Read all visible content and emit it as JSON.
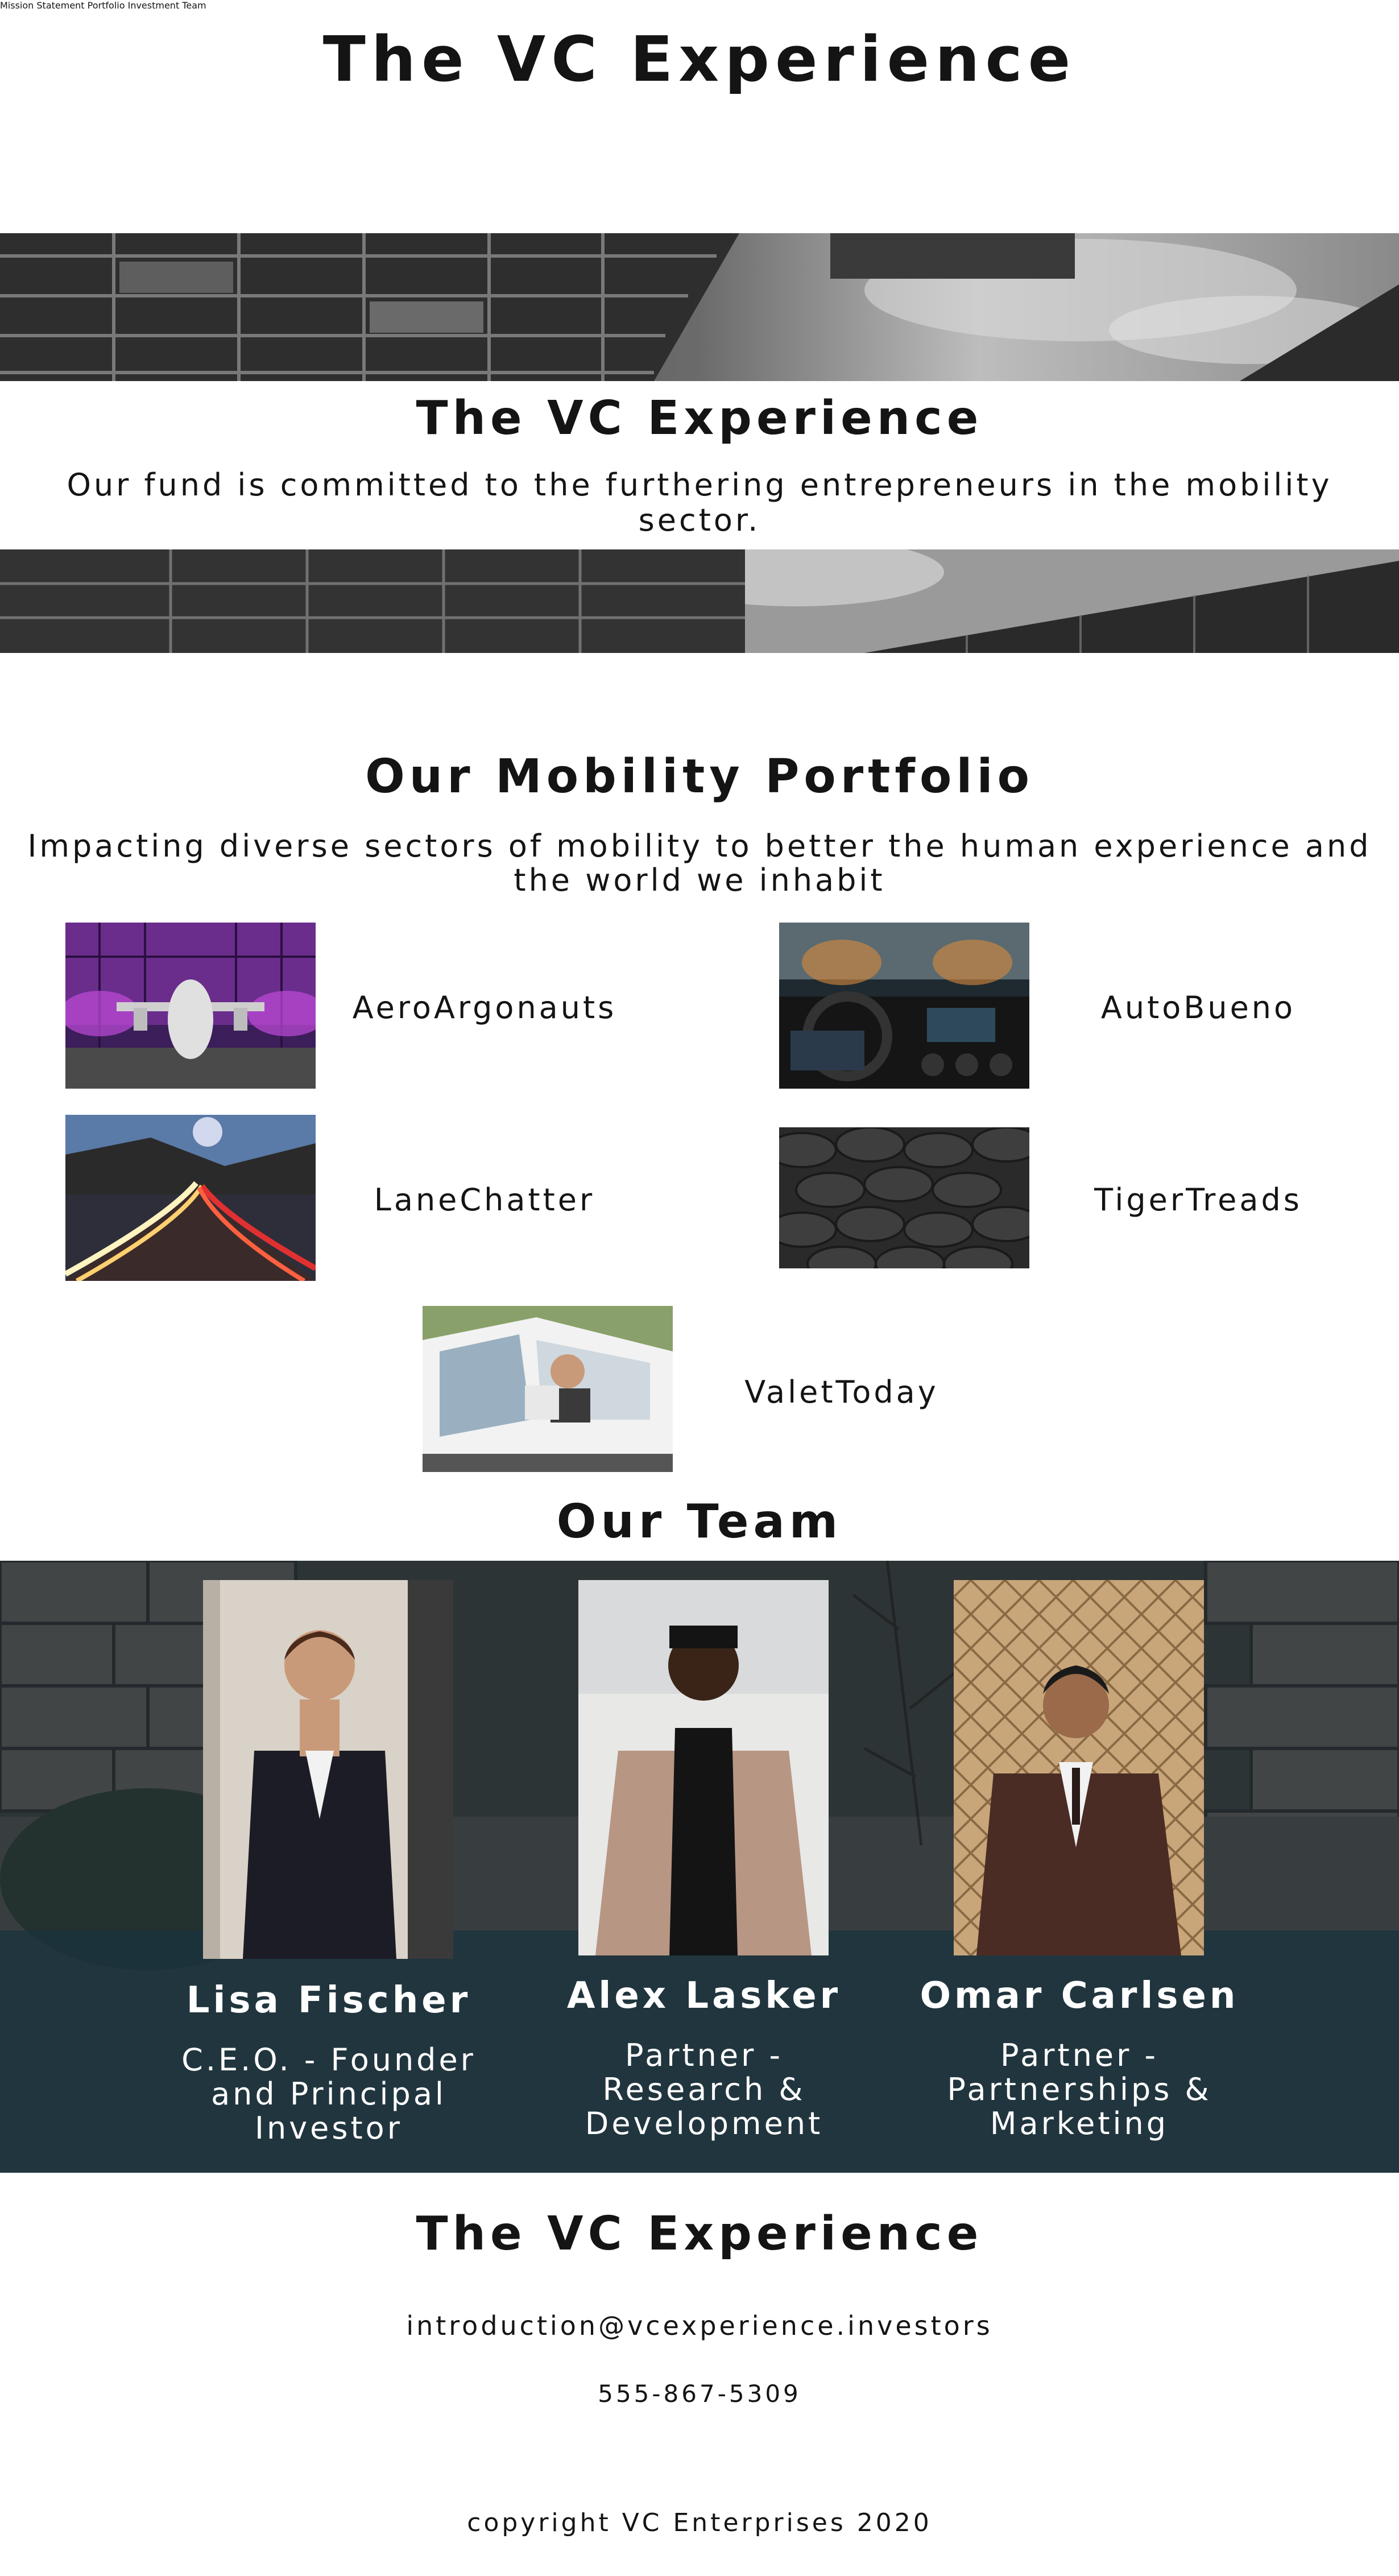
{
  "header": {
    "site_title": "The VC Experience",
    "nav": [
      "Mission Statement",
      "Portfolio",
      "Investment Team"
    ]
  },
  "hero": {
    "title": "The VC Experience",
    "subtitle": "Our fund is committed to the furthering entrepreneurs in the mobility sector."
  },
  "portfolio": {
    "title": "Our Mobility Portfolio",
    "subtitle": "Impacting diverse sectors of mobility to better the human experience and the world we inhabit",
    "companies": [
      "AeroArgonauts",
      "AutoBueno",
      "LaneChatter",
      "TigerTreads",
      "ValetToday"
    ]
  },
  "team": {
    "title": "Our Team",
    "members": [
      {
        "name": "Lisa Fischer",
        "role": "C.E.O. - Founder and Principal Investor"
      },
      {
        "name": "Alex Lasker",
        "role": "Partner - Research & Development"
      },
      {
        "name": "Omar Carlsen",
        "role": "Partner - Partnerships & Marketing"
      }
    ]
  },
  "footer": {
    "title": "The VC Experience",
    "email": "introduction@vcexperience.investors",
    "phone": "555-867-5309",
    "copyright": "copyright VC Enterprises 2020"
  },
  "colors": {
    "text": "#141414",
    "background": "#ffffff",
    "team_band": "#1c3440"
  }
}
